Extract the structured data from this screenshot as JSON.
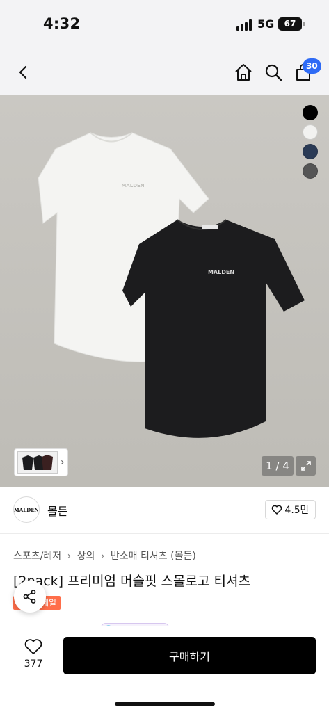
{
  "status_bar": {
    "time": "4:32",
    "network": "5G",
    "battery": "67"
  },
  "nav": {
    "cart_count": "30",
    "icons": [
      "back-icon",
      "home-icon",
      "search-icon",
      "cart-icon"
    ]
  },
  "product_image": {
    "background": "#c6c4bf",
    "logo_text": "MALDEN",
    "counter": "1 / 4",
    "swatch_colors": [
      "#000000",
      "#f2f2f0",
      "#2a3a55",
      "#555555"
    ]
  },
  "brand": {
    "logo_text": "MALDEN",
    "name": "몰든",
    "likes": "4.5만"
  },
  "breadcrumb": [
    "스포츠/레저",
    "상의",
    "반소매 티셔츠 (몰든)"
  ],
  "product": {
    "title": "[2pack] 프리미엄 머슬핏 스몰로고 티셔츠",
    "badge": "세일"
  },
  "bottom_bar": {
    "wish_count": "377",
    "buy_label": "구매하기"
  },
  "colors": {
    "accent": "#2f6bf5",
    "sale": "#ff6e4a",
    "buy_button": "#000000"
  }
}
